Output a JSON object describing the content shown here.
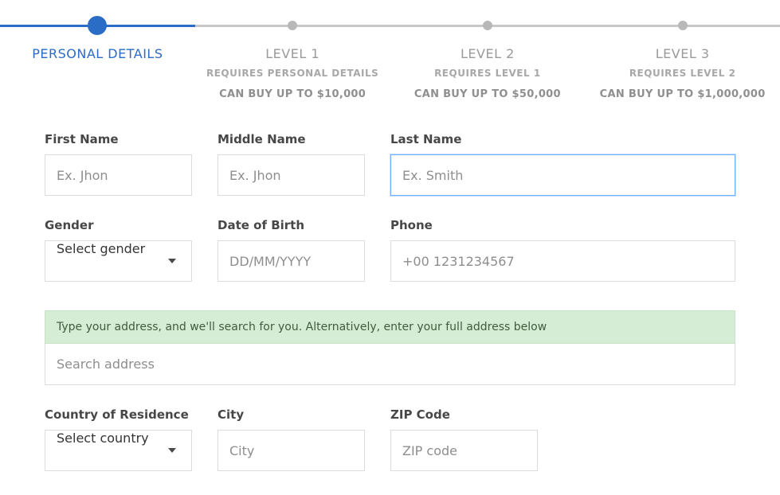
{
  "stepper": {
    "steps": [
      {
        "title": "PERSONAL DETAILS",
        "sub": "",
        "limit": "",
        "active": true
      },
      {
        "title": "LEVEL 1",
        "sub": "REQUIRES PERSONAL DETAILS",
        "limit": "CAN BUY UP TO $10,000",
        "active": false
      },
      {
        "title": "LEVEL 2",
        "sub": "REQUIRES LEVEL 1",
        "limit": "CAN BUY UP TO $50,000",
        "active": false
      },
      {
        "title": "LEVEL 3",
        "sub": "REQUIRES LEVEL 2",
        "limit": "CAN BUY UP TO $1,000,000",
        "active": false
      }
    ]
  },
  "form": {
    "first_name": {
      "label": "First Name",
      "placeholder": "Ex. Jhon",
      "value": ""
    },
    "middle_name": {
      "label": "Middle Name",
      "placeholder": "Ex. Jhon",
      "value": ""
    },
    "last_name": {
      "label": "Last Name",
      "placeholder": "Ex. Smith",
      "value": "",
      "focused": true
    },
    "gender": {
      "label": "Gender",
      "selected": "Select gender"
    },
    "dob": {
      "label": "Date of Birth",
      "placeholder": "DD/MM/YYYY",
      "value": ""
    },
    "phone": {
      "label": "Phone",
      "placeholder": "+00 1231234567",
      "value": ""
    },
    "address_hint": "Type your address, and we'll search for you. Alternatively, enter your full address below",
    "address_search": {
      "placeholder": "Search address",
      "value": ""
    },
    "country": {
      "label": "Country of Residence",
      "selected": "Select country"
    },
    "city": {
      "label": "City",
      "placeholder": "City",
      "value": ""
    },
    "zip": {
      "label": "ZIP Code",
      "placeholder": "ZIP code",
      "value": ""
    }
  }
}
